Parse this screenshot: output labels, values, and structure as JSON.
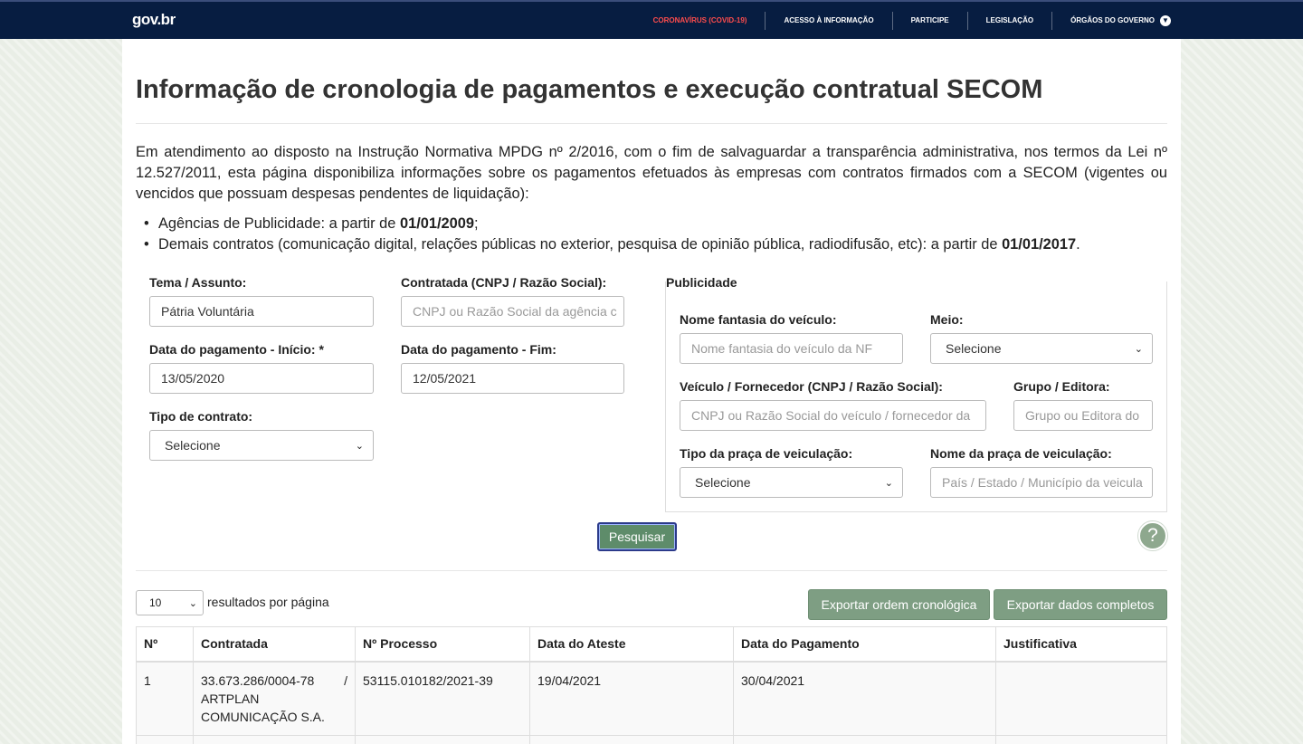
{
  "topbar": {
    "logo": "gov.br",
    "nav": [
      "CORONAVÍRUS (COVID-19)",
      "ACESSO À INFORMAÇÃO",
      "PARTICIPE",
      "LEGISLAÇÃO",
      "ÓRGÃOS DO GOVERNO"
    ],
    "colors": {
      "background": "#071d41",
      "covid": "#ff4c4c"
    }
  },
  "page": {
    "title": "Informação de cronologia de pagamentos e execução contratual SECOM",
    "intro": "Em atendimento ao disposto na Instrução Normativa MPDG nº 2/2016, com o fim de salvaguardar a transparência administrativa, nos termos da Lei nº 12.527/2011, esta página disponibiliza informações sobre os pagamentos efetuados às empresas com contratos firmados com a SECOM (vigentes ou vencidos que possuam despesas pendentes de liquidação):",
    "bullets": [
      {
        "text": "Agências de Publicidade: a partir de ",
        "bold": "01/01/2009",
        "end": ";"
      },
      {
        "text": "Demais contratos (comunicação digital, relações públicas no exterior, pesquisa de opinião pública, radiodifusão, etc): a partir de ",
        "bold": "01/01/2017",
        "end": "."
      }
    ]
  },
  "form": {
    "tema_label": "Tema / Assunto:",
    "tema_value": "Pátria Voluntária",
    "contratada_label": "Contratada (CNPJ / Razão Social):",
    "contratada_placeholder": "CNPJ ou Razão Social da agência c",
    "inicio_label": "Data do pagamento - Início: *",
    "inicio_value": "13/05/2020",
    "fim_label": "Data do pagamento - Fim:",
    "fim_value": "12/05/2021",
    "tipo_label": "Tipo de contrato:",
    "tipo_value": "Selecione",
    "publicidade": {
      "title": "Publicidade",
      "nome_label": "Nome fantasia do veículo:",
      "nome_placeholder": "Nome fantasia do veículo da NF",
      "meio_label": "Meio:",
      "meio_value": "Selecione",
      "veiculo_label": "Veículo / Fornecedor (CNPJ / Razão Social):",
      "veiculo_placeholder": "CNPJ ou Razão Social do veículo / fornecedor da",
      "grupo_label": "Grupo / Editora:",
      "grupo_placeholder": "Grupo ou Editora do",
      "praca_tipo_label": "Tipo da praça de veiculação:",
      "praca_tipo_value": "Selecione",
      "praca_nome_label": "Nome da praça de veiculação:",
      "praca_nome_placeholder": "País / Estado / Município da veicula"
    },
    "search_button": "Pesquisar",
    "help": "?"
  },
  "results": {
    "per_page_value": "10",
    "per_page_label": "resultados por página",
    "export_chrono": "Exportar ordem cronológica",
    "export_full": "Exportar dados completos",
    "columns": [
      "Nº",
      "Contratada",
      "Nº Processo",
      "Data do Ateste",
      "Data do Pagamento",
      "Justificativa"
    ],
    "rows": [
      {
        "n": "1",
        "cnpj": "33.673.286/0004-78",
        "sep": "/",
        "contratada": "ARTPLAN COMUNICAÇÃO S.A.",
        "processo": "53115.010182/2021-39",
        "ateste": "19/04/2021",
        "pagamento": "30/04/2021",
        "justificativa": ""
      }
    ]
  },
  "colors": {
    "button_green": "#5e8c6a",
    "export_green": "#7e9e83"
  }
}
